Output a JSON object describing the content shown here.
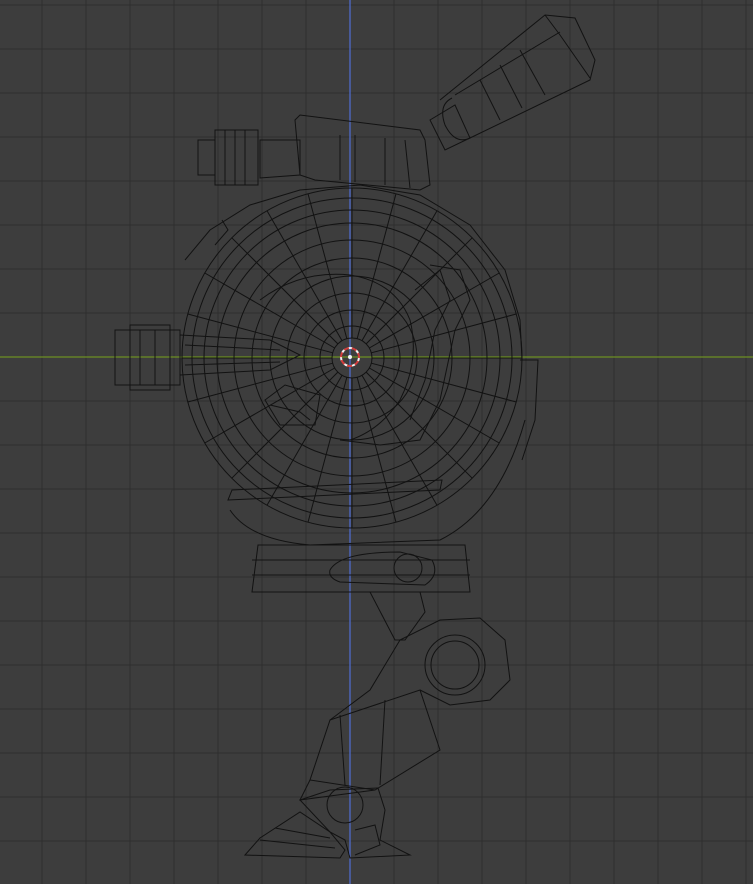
{
  "viewport": {
    "view": "wireframe",
    "colors": {
      "background": "#3d3d3d",
      "grid_line": "#2f2f2f",
      "x_axis": "#6b8e23",
      "z_axis": "#4f6fd6",
      "wire": "#121212",
      "origin_outer": "#f2f2f2",
      "origin_inner": "#d23c3c"
    },
    "icons": {
      "origin": "3d-cursor-icon"
    }
  }
}
